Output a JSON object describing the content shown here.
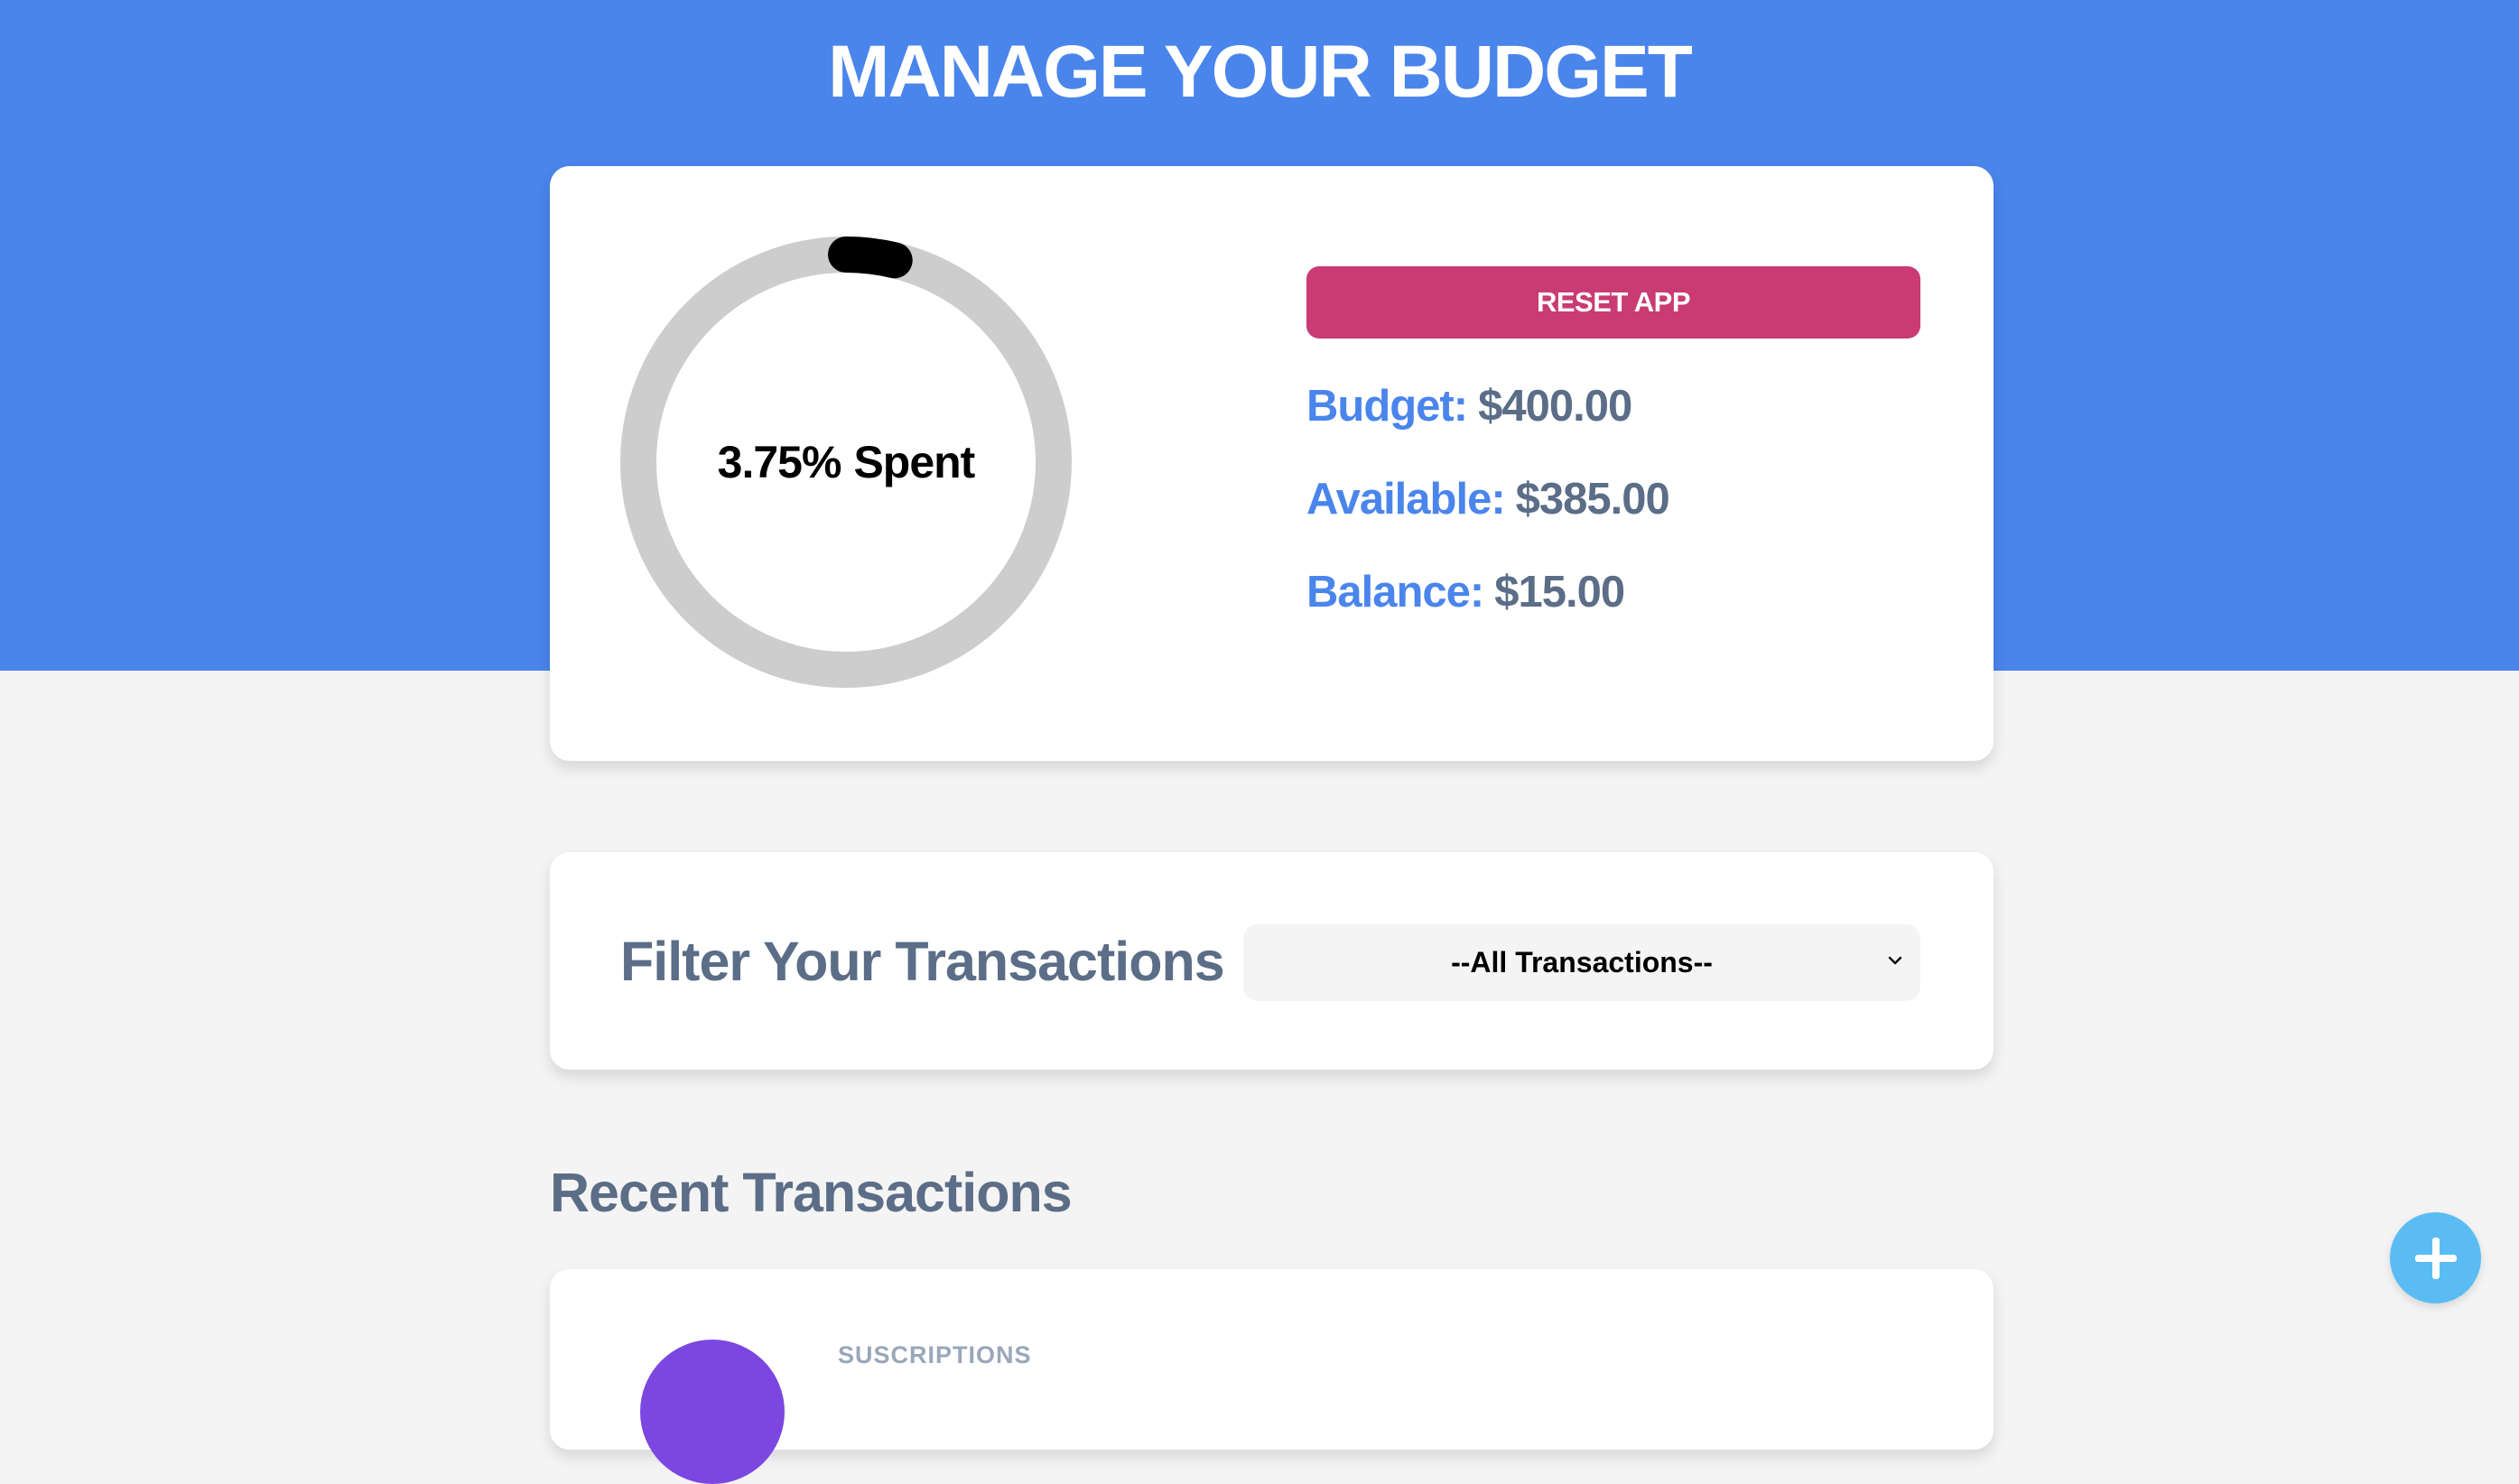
{
  "header": {
    "title": "MANAGE YOUR BUDGET"
  },
  "summary": {
    "spent_percent": 3.75,
    "spent_value": "3.75%",
    "spent_suffix": "Spent",
    "reset_label": "RESET APP",
    "budget_label": "Budget:",
    "budget_value": "$400.00",
    "available_label": "Available:",
    "available_value": "$385.00",
    "balance_label": "Balance:",
    "balance_value": "$15.00"
  },
  "filter": {
    "heading": "Filter Your Transactions",
    "selected": "--All Transactions--"
  },
  "recent": {
    "heading": "Recent Transactions",
    "items": [
      {
        "category": "SUSCRIPTIONS"
      }
    ]
  },
  "colors": {
    "hero": "#4a85ec",
    "reset": "#c93b72",
    "label": "#4a85ec",
    "value": "#5b6d87",
    "fab": "#5bbcf4",
    "avatar": "#7b47e0"
  },
  "icons": {
    "fab": "plus-icon",
    "select": "chevron-down-icon"
  }
}
